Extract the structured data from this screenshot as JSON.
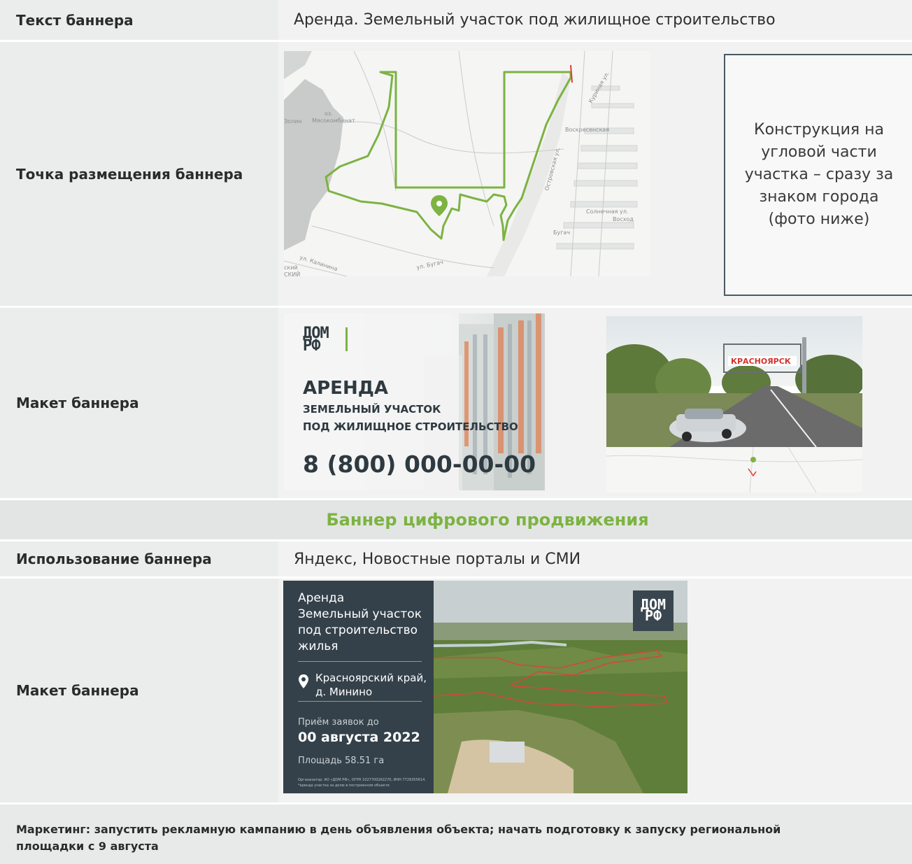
{
  "rows": {
    "banner_text": {
      "label": "Текст баннера",
      "value": "Аренда. Земельный участок под жилищное строительство"
    },
    "placement": {
      "label": "Точка размещения баннера",
      "note": "Конструкция на угловой части участка – сразу за знаком города (фото ниже)"
    },
    "layout1": {
      "label": "Макет баннера"
    },
    "section": {
      "title": "Баннер цифрового продвижения"
    },
    "usage": {
      "label": "Использование баннера",
      "value": "Яндекс, Новостные порталы и СМИ"
    },
    "layout2": {
      "label": "Макет баннера"
    }
  },
  "map": {
    "labels": {
      "lake": "оз.",
      "lake2": "Мясокомбинат",
      "voskr": "Воскресенская",
      "ostr": "Островская ул.",
      "kurin": "Куриная ул.",
      "soln": "Солнечная ул.",
      "vosh": "Восход",
      "bugach": "Бугач",
      "kalinina": "ул. Калинина",
      "bugach_st": "ул. Бугач",
      "zoline": "Золин",
      "skiy": "ский",
      "sky2": "СКИЙ"
    }
  },
  "banner1": {
    "logo_top": "ДОМ",
    "logo_bottom": "РФ",
    "heading": "АРЕНДА",
    "sub1": "ЗЕМЕЛЬНЫЙ УЧАСТОК",
    "sub2": "ПОД ЖИЛИЩНОЕ СТРОИТЕЛЬСТВО",
    "phone": "8 (800) 000-00-00"
  },
  "photo": {
    "sign": "КРАСНОЯРСК"
  },
  "banner2": {
    "l1": "Аренда",
    "l2": "Земельный участок",
    "l3": "под строительство",
    "l4": "жилья",
    "region1": "Красноярский край,",
    "region2": "д. Минино",
    "deadline_label": "Приём заявок до",
    "deadline": "00 августа 2022",
    "area": "Площадь 58.51 га",
    "fine1": "Организатор: АО «ДОМ.РФ», ОГРН 1027700262270, ИНН 7729355614.",
    "fine2": "*аренда участка за долю в построенном объекте",
    "logo_top": "ДОМ",
    "logo_bottom": "РФ"
  },
  "footer": {
    "text": "Маркетинг: запустить рекламную кампанию в день объявления объекта; начать подготовку к запуску региональной площадки с 9 августа"
  },
  "colors": {
    "accent": "#7cb342",
    "label_bg": "#ebedec",
    "value_bg": "#f1f2f1",
    "dark": "#34414a"
  }
}
